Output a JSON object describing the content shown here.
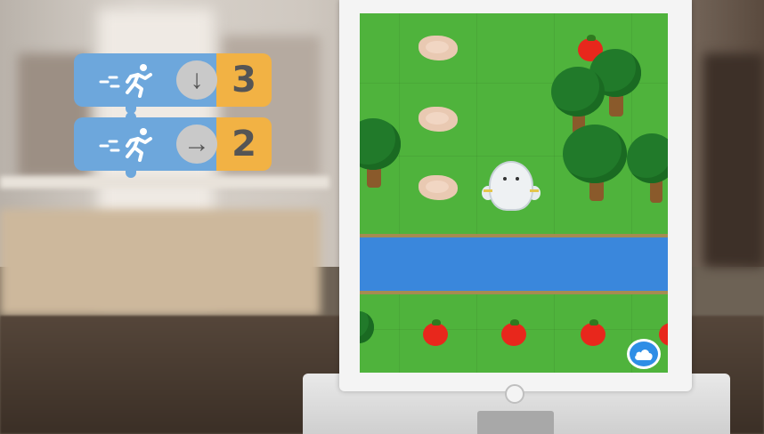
{
  "scene": {
    "description_visible_text": null
  },
  "code_blocks": [
    {
      "action_icon": "running-person-icon",
      "direction_icon": "arrow-down-icon",
      "direction_glyph": "↓",
      "count": "3",
      "color_action": "#6da7dc",
      "color_count": "#f2b244"
    },
    {
      "action_icon": "running-person-icon",
      "direction_icon": "arrow-right-icon",
      "direction_glyph": "→",
      "count": "2",
      "color_action": "#6da7dc",
      "color_count": "#f2b244"
    }
  ],
  "game": {
    "grass_color": "#4fb33c",
    "river_color": "#3a87dc",
    "tomato_color": "#e8271c",
    "character": "white-monster",
    "action_button_icon": "cloud-icon"
  }
}
